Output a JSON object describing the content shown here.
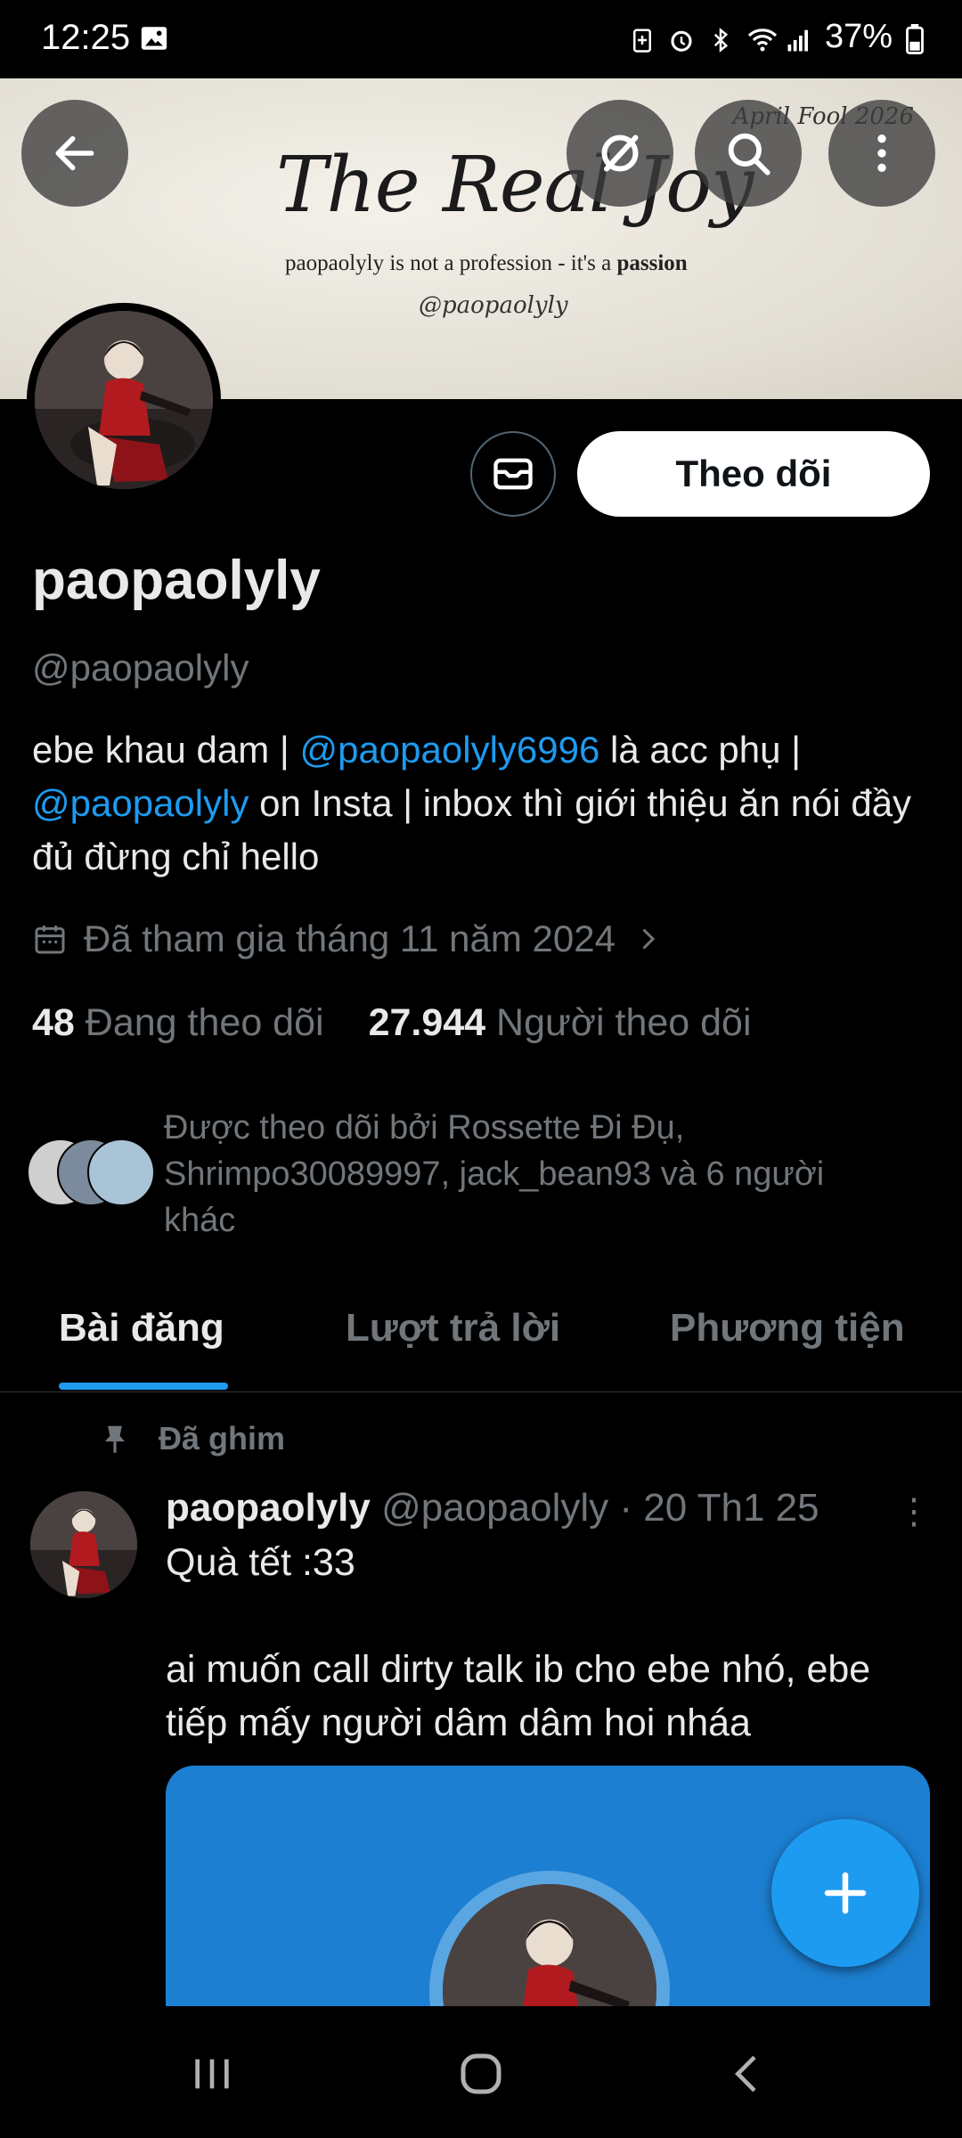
{
  "status_bar": {
    "time": "12:25",
    "battery": "37%",
    "icons": [
      "image-icon",
      "battery-saver-icon",
      "alarm-icon",
      "bluetooth-icon",
      "wifi-icon",
      "signal-icon",
      "battery-icon"
    ]
  },
  "banner": {
    "title": "The Real Joy",
    "subtitle_prefix": "paopaolyly is not a profession - it's a ",
    "subtitle_bold": "passion",
    "handle": "@paopaolyly",
    "corner_text": "April Fool 2026"
  },
  "actions": {
    "follow_label": "Theo dõi"
  },
  "profile": {
    "display_name": "paopaolyly",
    "handle": "@paopaolyly",
    "bio_part1": "ebe khau dam | ",
    "bio_mention1": "@paopaolyly6996",
    "bio_part2": " là acc phụ | ",
    "bio_mention2": "@paopaolyly",
    "bio_part3": " on Insta | inbox thì giới thiệu ăn nói đầy đủ đừng chỉ hello",
    "joined": "Đã tham gia tháng 11 năm 2024",
    "following_count": "48",
    "following_label": "Đang theo dõi",
    "followers_count": "27.944",
    "followers_label": "Người theo dõi",
    "followed_by": "Được theo dõi bởi Rossette Đi Đụ, Shrimpo30089997, jack_bean93 và 6 người khác"
  },
  "tabs": [
    {
      "label": "Bài đăng",
      "active": true
    },
    {
      "label": "Lượt trả lời",
      "active": false
    },
    {
      "label": "Phương tiện",
      "active": false
    }
  ],
  "post": {
    "pinned_label": "Đã ghim",
    "author": "paopaolyly",
    "handle_date": "@paopaolyly · 20 Th1 25",
    "more": "⋮",
    "text": "Quà tết :33\n\nai muốn call dirty talk ib cho ebe nhó, ebe tiếp mấy người dâm dâm hoi nháa"
  },
  "colors": {
    "accent": "#1d9bf0",
    "background": "#000000",
    "text": "#e7e9ea",
    "muted": "#71767b"
  }
}
